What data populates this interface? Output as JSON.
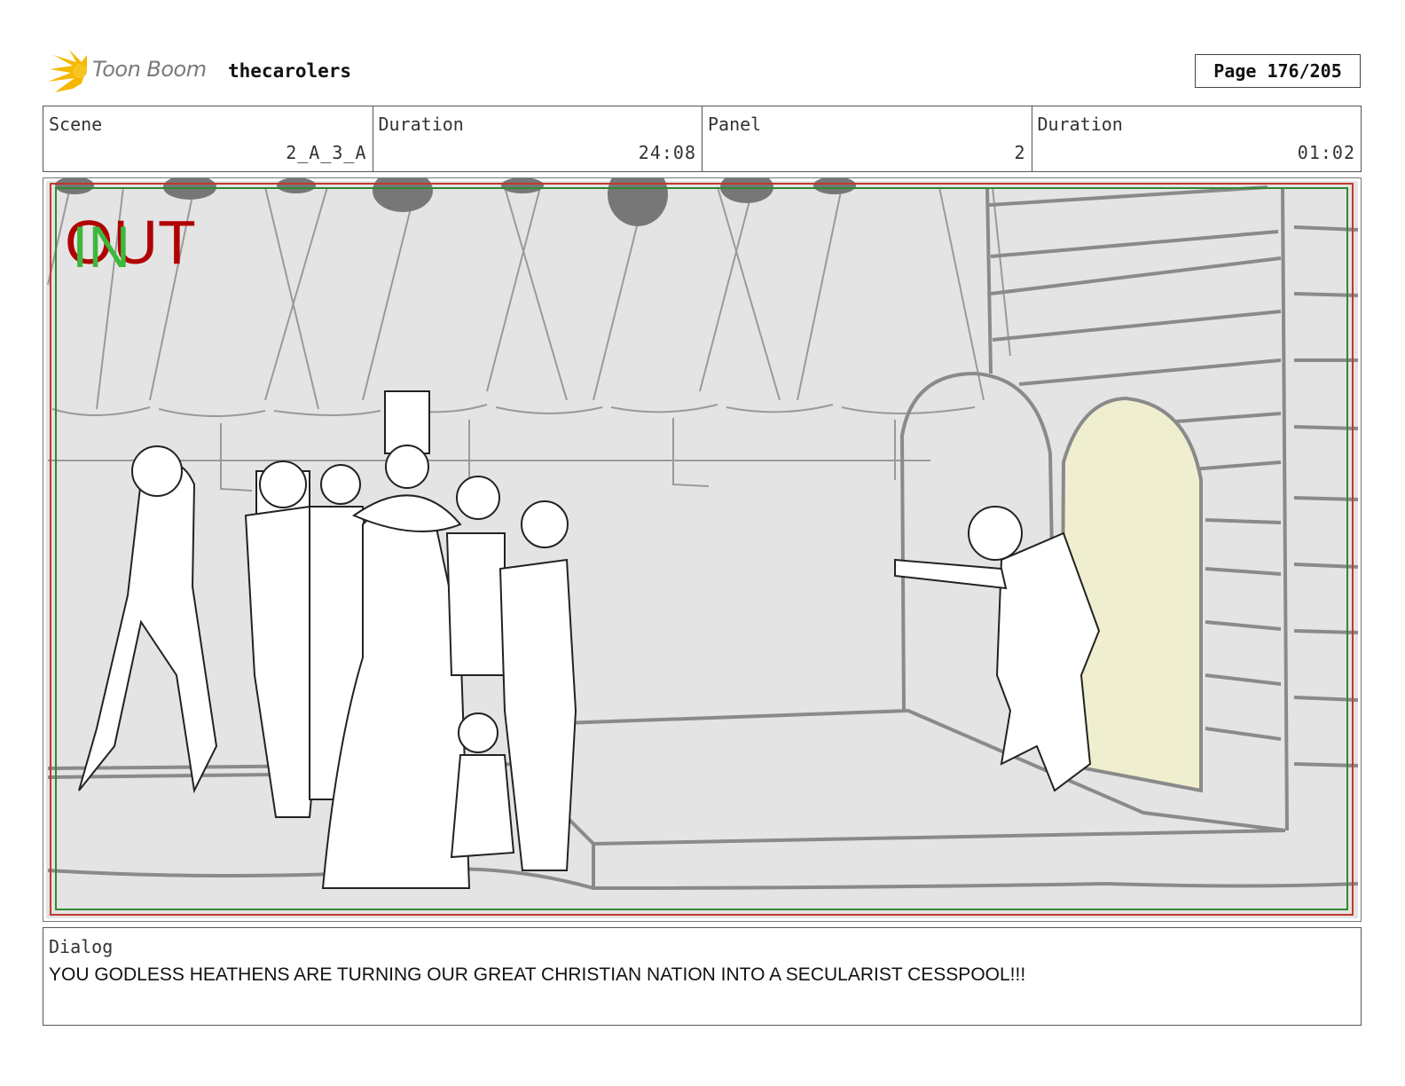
{
  "header": {
    "logo_text": "Toon Boom",
    "project_name": "thecarolers",
    "page_label": "Page 176/205"
  },
  "info": {
    "scene_label": "Scene",
    "scene_value": "2_A_3_A",
    "scene_duration_label": "Duration",
    "scene_duration_value": "24:08",
    "panel_label": "Panel",
    "panel_value": "2",
    "panel_duration_label": "Duration",
    "panel_duration_value": "01:02"
  },
  "panel": {
    "overlay_out": "OUT",
    "overlay_in": "IN"
  },
  "dialog": {
    "label": "Dialog",
    "text": "YOU GODLESS HEATHENS ARE TURNING OUR GREAT CHRISTIAN NATION INTO A SECULARIST CESSPOOL!!!"
  },
  "colors": {
    "logo_star": "#f5b800",
    "safe_frame_red": "#c0392b",
    "safe_frame_green": "#2e8b2e",
    "doorway_fill": "#efefcf",
    "background_fill": "#e4e4e4"
  }
}
